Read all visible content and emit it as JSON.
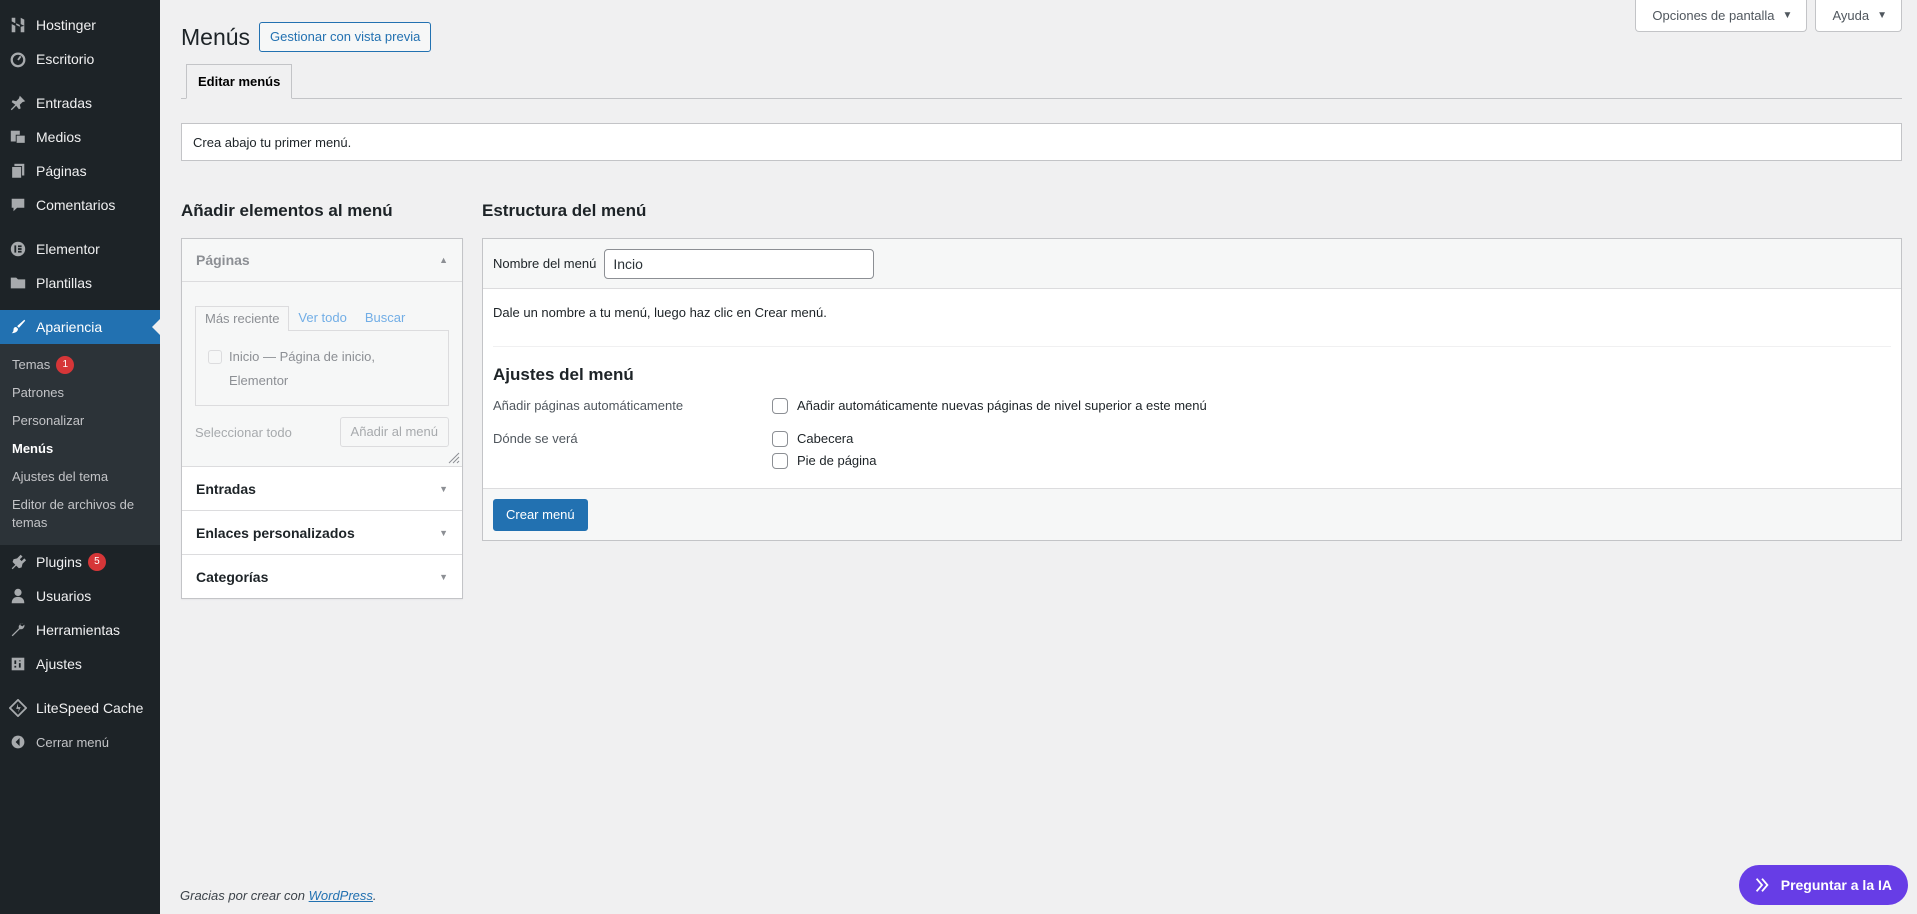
{
  "sidebar": {
    "hostinger": "Hostinger",
    "escritorio": "Escritorio",
    "entradas": "Entradas",
    "medios": "Medios",
    "paginas": "Páginas",
    "comentarios": "Comentarios",
    "elementor": "Elementor",
    "plantillas": "Plantillas",
    "apariencia": "Apariencia",
    "submenu": {
      "temas": "Temas",
      "temas_badge": "1",
      "patrones": "Patrones",
      "personalizar": "Personalizar",
      "menus": "Menús",
      "ajustes_tema": "Ajustes del tema",
      "editor": "Editor de archivos de temas"
    },
    "plugins": "Plugins",
    "plugins_badge": "5",
    "usuarios": "Usuarios",
    "herramientas": "Herramientas",
    "ajustes": "Ajustes",
    "litespeed": "LiteSpeed Cache",
    "cerrar": "Cerrar menú"
  },
  "header": {
    "title": "Menús",
    "preview_button": "Gestionar con vista previa",
    "screen_options": "Opciones de pantalla",
    "help": "Ayuda"
  },
  "tabs": {
    "edit_menus": "Editar menús"
  },
  "notice": "Crea abajo tu primer menú.",
  "add_items": {
    "heading": "Añadir elementos al menú",
    "sections": {
      "paginas": "Páginas",
      "entradas": "Entradas",
      "enlaces": "Enlaces personalizados",
      "categorias": "Categorías"
    },
    "inner_tabs": {
      "recent": "Más reciente",
      "all": "Ver todo",
      "search": "Buscar"
    },
    "page_option": "Inicio — Página de inicio, Elementor",
    "select_all": "Seleccionar todo",
    "add_button": "Añadir al menú"
  },
  "structure": {
    "heading": "Estructura del menú",
    "name_label": "Nombre del menú",
    "name_value": "Incio",
    "instructions": "Dale un nombre a tu menú, luego haz clic en Crear menú.",
    "settings_heading": "Ajustes del menú",
    "auto_add_label": "Añadir páginas automáticamente",
    "auto_add_option": "Añadir automáticamente nuevas páginas de nivel superior a este menú",
    "locations_label": "Dónde se verá",
    "location_header": "Cabecera",
    "location_footer": "Pie de página",
    "create_button": "Crear menú"
  },
  "footer": {
    "text": "Gracias por crear con",
    "link": "WordPress",
    "period": "."
  },
  "ai_button": "Preguntar a la IA",
  "colors": {
    "sidebar_bg": "#1d2327",
    "accent": "#2271b1",
    "ai_purple": "#673de6",
    "badge_red": "#d63638"
  }
}
